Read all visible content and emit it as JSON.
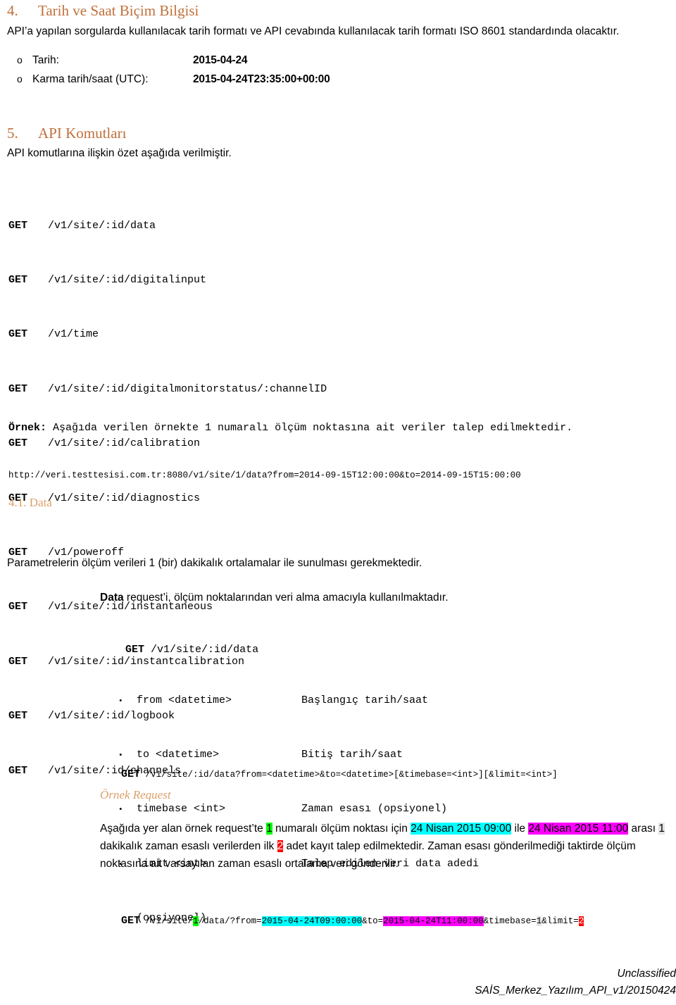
{
  "section_date": {
    "number": "4.",
    "title": "Tarih ve Saat Biçim Bilgisi",
    "intro": "API’a yapılan sorgularda kullanılacak tarih formatı ve API cevabında kullanılacak tarih formatı ISO 8601 standardında olacaktır.",
    "items": [
      {
        "mark": "o",
        "label": "Tarih:",
        "value": "2015-04-24"
      },
      {
        "mark": "o",
        "label": "Karma tarih/saat (UTC):",
        "value": "2015-04-24T23:35:00+00:00"
      }
    ]
  },
  "section_commands": {
    "number": "5.",
    "title": "API Komutları",
    "intro": "API komutlarına ilişkin özet aşağıda verilmiştir.",
    "endpoints": [
      {
        "verb": "GET",
        "path": "/v1/site/:id/data"
      },
      {
        "verb": "GET",
        "path": "/v1/site/:id/digitalinput"
      },
      {
        "verb": "GET",
        "path": "/v1/time"
      },
      {
        "verb": "GET",
        "path": "/v1/site/:id/digitalmonitorstatus/:channelID"
      },
      {
        "verb": "GET",
        "path": "/v1/site/:id/calibration"
      },
      {
        "verb": "GET",
        "path": "/v1/site/:id/diagnostics"
      },
      {
        "verb": "GET",
        "path": "/v1/poweroff"
      },
      {
        "verb": "GET",
        "path": "/v1/site/:id/instantaneous"
      },
      {
        "verb": "GET",
        "path": "/v1/site/:id/instantcalibration"
      },
      {
        "verb": "GET",
        "path": "/v1/site/:id/logbook"
      },
      {
        "verb": "GET",
        "path": "/v1/site/:id/channels"
      }
    ],
    "example_label": "Örnek:",
    "example_text": " Aşağıda verilen örnekte 1 numaralı ölçüm noktasına ait veriler talep edilmektedir.",
    "example_url": "http://veri.testtesisi.com.tr:8080/v1/site/1/data?from=2014-09-15T12:00:00&to=2014-09-15T15:00:00"
  },
  "section_data": {
    "heading": "4.1. Data",
    "note": "Parametrelerin ölçüm verileri 1 (bir) dakikalık ortalamalar ile sunulması gerekmektedir.",
    "desc_bold": "Data",
    "desc_rest": " request’i, ölçüm noktalarından veri alma amacıyla kullanılmaktadır.",
    "endpoint": {
      "verb": "GET",
      "path": "/v1/site/:id/data"
    },
    "params": [
      {
        "name": "from <datetime>",
        "desc": "Başlangıç tarih/saat"
      },
      {
        "name": "to <datetime>",
        "desc": "Bitiş tarih/saat"
      },
      {
        "name": "timebase <int>",
        "desc": "Zaman esası (opsiyonel)"
      },
      {
        "name": "limit <int>",
        "desc": "Talep edilen veri data adedi"
      }
    ],
    "params_continuation": "(opsiyonel)",
    "syntax": {
      "verb": "GET",
      "path": "/v1/site/:id/data?from=<datetime>&to=<datetime>[&timebase=<int>][&limit=<int>]"
    },
    "example_heading": "Örnek Request",
    "example_paragraph": {
      "p1": "Aşağıda yer alan örnek request’te ",
      "hl_site": "1",
      "p2": " numaralı ölçüm noktası için ",
      "hl_from": "24 Nisan 2015 09:00",
      "p3": " ile ",
      "hl_to": "24 Nisan 2015 11:00",
      "p4": " arası ",
      "hl_timebase": "1",
      "p5": " dakikalık zaman esaslı verilerden ilk ",
      "hl_limit": "2",
      "p6": " adet kayıt talep edilmektedir. Zaman esası gönderilmediği taktirde ölçüm noktasına ait varsayılan zaman esaslı ortalama veri gönderilir."
    },
    "example_request": {
      "verb": "GET",
      "seg1": "/v1/site/",
      "hl_site": "1",
      "seg2": "/data/?from=",
      "hl_from": "2015-04-24T09:00:00",
      "seg3": "&to=",
      "hl_to": "2015-04-24T11:00:00",
      "seg4": "&timebase=",
      "hl_timebase": "1",
      "seg5": "&limit=",
      "hl_limit": "2"
    }
  },
  "footer": {
    "classification": "Unclassified",
    "document_id": "SAİS_Merkez_Yazılım_API_v1/20150424"
  },
  "colors": {
    "heading": "#C0703A",
    "subheading": "#DCA06A",
    "highlight_green": "#00FF00",
    "highlight_cyan": "#00FFFF",
    "highlight_magenta": "#FF00FF",
    "highlight_gray": "#E3E3E3",
    "highlight_red": "#FF0000"
  }
}
